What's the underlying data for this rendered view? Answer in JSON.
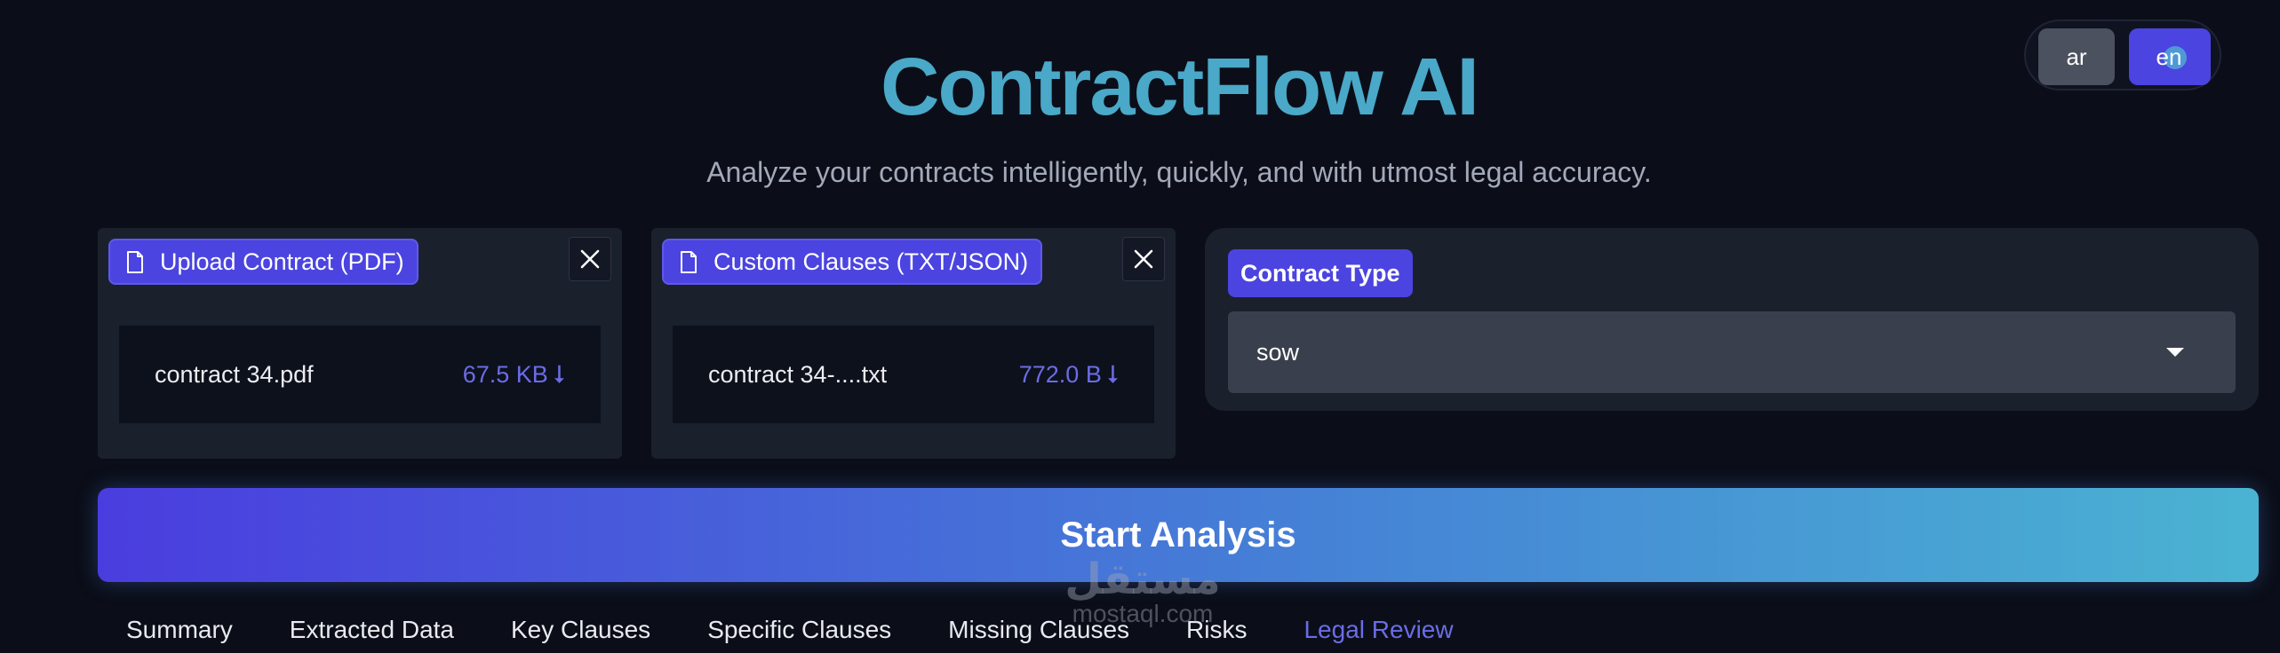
{
  "language_toggle": {
    "options": [
      "ar",
      "en"
    ],
    "selected": "en"
  },
  "header": {
    "title": "ContractFlow AI",
    "subtitle": "Analyze your contracts intelligently, quickly, and with utmost legal accuracy."
  },
  "upload_contract": {
    "label": "Upload Contract (PDF)",
    "file_name": "contract 34.pdf",
    "file_size": "67.5 KB"
  },
  "custom_clauses": {
    "label": "Custom Clauses (TXT/JSON)",
    "file_name": "contract 34-....txt",
    "file_size": "772.0 B"
  },
  "contract_type": {
    "label": "Contract Type",
    "value": "sow"
  },
  "start_button": {
    "label": "Start Analysis"
  },
  "tabs": [
    {
      "label": "Summary"
    },
    {
      "label": "Extracted Data"
    },
    {
      "label": "Key Clauses"
    },
    {
      "label": "Specific Clauses"
    },
    {
      "label": "Missing Clauses"
    },
    {
      "label": "Risks"
    },
    {
      "label": "Legal Review",
      "active": true
    }
  ],
  "watermark": {
    "text_ar": "مستقل",
    "text_en": "mostaql.com"
  },
  "colors": {
    "background": "#0b0e18",
    "accent": "#4b44e0",
    "title": "#4aa8c8",
    "active_tab": "#6b6ce6"
  }
}
